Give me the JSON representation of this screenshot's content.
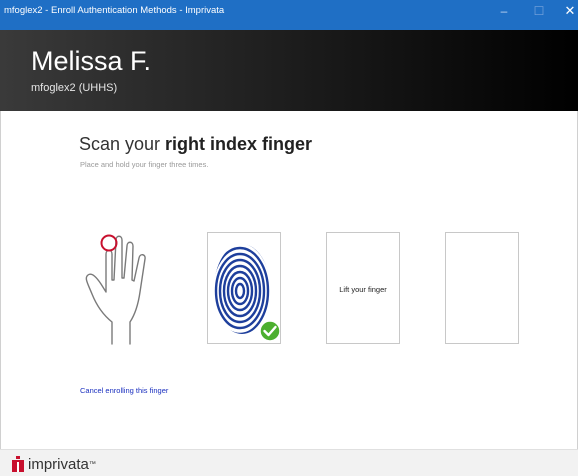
{
  "window": {
    "title": "mfoglex2 - Enroll Authentication Methods - Imprivata",
    "minimize": "–",
    "maximize": "☐",
    "close": "✕"
  },
  "header": {
    "name": "Melissa F.",
    "username": "mfoglex2 (UHHS)"
  },
  "main": {
    "heading_prefix": "Scan your ",
    "heading_bold": "right index finger",
    "instruction": "Place and hold your finger three times.",
    "scans": [
      {
        "status": "complete",
        "icon": "fingerprint-icon",
        "badge": "checkmark-icon"
      },
      {
        "status": "waiting",
        "text": "Lift your finger"
      },
      {
        "status": "pending",
        "text": ""
      }
    ],
    "cancel_link": "Cancel enrolling this finger"
  },
  "footer": {
    "logo_text": "imprivata",
    "logo_mark": "™"
  },
  "colors": {
    "titlebar": "#1f6fc5",
    "fingerprint": "#1e3f9c",
    "check": "#4caf2f",
    "link": "#1a2fbf",
    "brand": "#c8102e"
  }
}
